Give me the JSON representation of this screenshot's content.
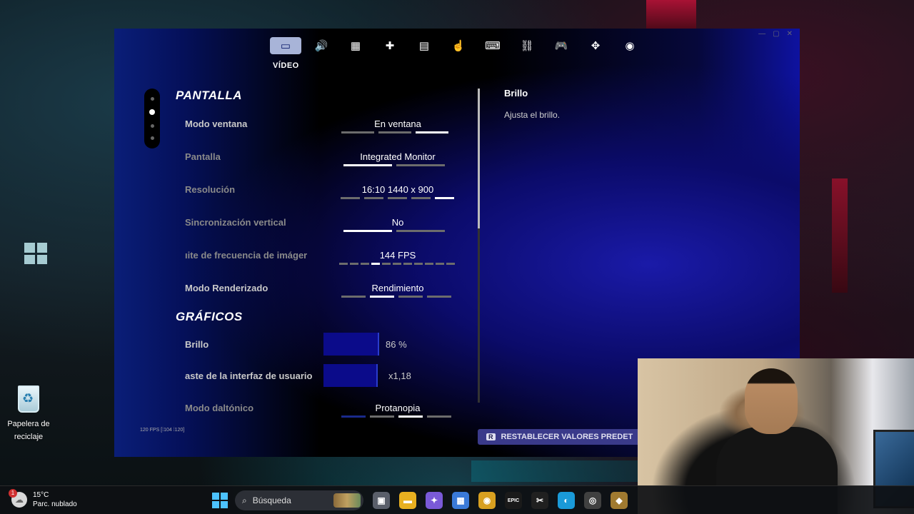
{
  "desktop": {
    "recycle_bin_label": "Papelera de reciclaje"
  },
  "game": {
    "nav": {
      "active_label": "VÍDEO",
      "tabs": [
        {
          "icon": "monitor-icon",
          "glyph": "▭"
        },
        {
          "icon": "speaker-icon",
          "glyph": "🔊"
        },
        {
          "icon": "grid-icon",
          "glyph": "▦"
        },
        {
          "icon": "gamepad-wireless-icon",
          "glyph": "✚"
        },
        {
          "icon": "window-icon",
          "glyph": "▤"
        },
        {
          "icon": "touch-icon",
          "glyph": "☝"
        },
        {
          "icon": "keyboard-mouse-icon",
          "glyph": "⌨"
        },
        {
          "icon": "network-icon",
          "glyph": "⛓"
        },
        {
          "icon": "controller-icon",
          "glyph": "🎮"
        },
        {
          "icon": "dpad-icon",
          "glyph": "✥"
        },
        {
          "icon": "account-icon",
          "glyph": "◉"
        }
      ]
    },
    "sections": {
      "pantalla": "PANTALLA",
      "graficos": "GRÁFICOS"
    },
    "rows": {
      "modo_ventana": {
        "label": "Modo ventana",
        "value": "En ventana"
      },
      "pantalla": {
        "label": "Pantalla",
        "value": "Integrated Monitor"
      },
      "resolucion": {
        "label": "Resolución",
        "value": "16:10 1440 x 900"
      },
      "sincronizacion": {
        "label": "Sincronización vertical",
        "value": "No"
      },
      "limite_fps": {
        "label": "ıite de frecuencia de imáger",
        "value": "144 FPS"
      },
      "modo_renderizado": {
        "label": "Modo Renderizado",
        "value": "Rendimiento"
      },
      "brillo": {
        "label": "Brillo",
        "value": "86 %",
        "level": 0.86
      },
      "contraste": {
        "label": "aste de la interfaz de usuario",
        "value": "x1,18"
      },
      "daltonico": {
        "label": "Modo daltónico",
        "value": "Protanopia"
      }
    },
    "description": {
      "title": "Brillo",
      "text": "Ajusta el brillo."
    },
    "reset_key": "R",
    "reset_label": "RESTABLECER VALORES PREDET",
    "fps_counter": "120 FPS [⁞104 ⁞120]"
  },
  "taskbar": {
    "weather_temp": "15°C",
    "weather_desc": "Parc. nublado",
    "notification_count": "1",
    "search_placeholder": "Búsqueda",
    "apps": [
      {
        "name": "task-view-icon",
        "glyph": "▣",
        "color": "#5a5f6a"
      },
      {
        "name": "file-explorer-icon",
        "glyph": "▬",
        "color": "#e8b020"
      },
      {
        "name": "copilot-icon",
        "glyph": "✦",
        "color": "#7a5ad8"
      },
      {
        "name": "store-icon",
        "glyph": "▦",
        "color": "#3a7ad8"
      },
      {
        "name": "chrome-icon",
        "glyph": "◉",
        "color": "#d8a020"
      },
      {
        "name": "epic-games-icon",
        "glyph": "EPIC",
        "color": "#1a1a1a"
      },
      {
        "name": "capcut-icon",
        "glyph": "✂",
        "color": "#202020"
      },
      {
        "name": "edge-icon",
        "glyph": "◐",
        "color": "#1a9ad8"
      },
      {
        "name": "recorder-icon",
        "glyph": "◎",
        "color": "#404040"
      },
      {
        "name": "game-app-icon",
        "glyph": "◆",
        "color": "#a07a30"
      }
    ]
  }
}
